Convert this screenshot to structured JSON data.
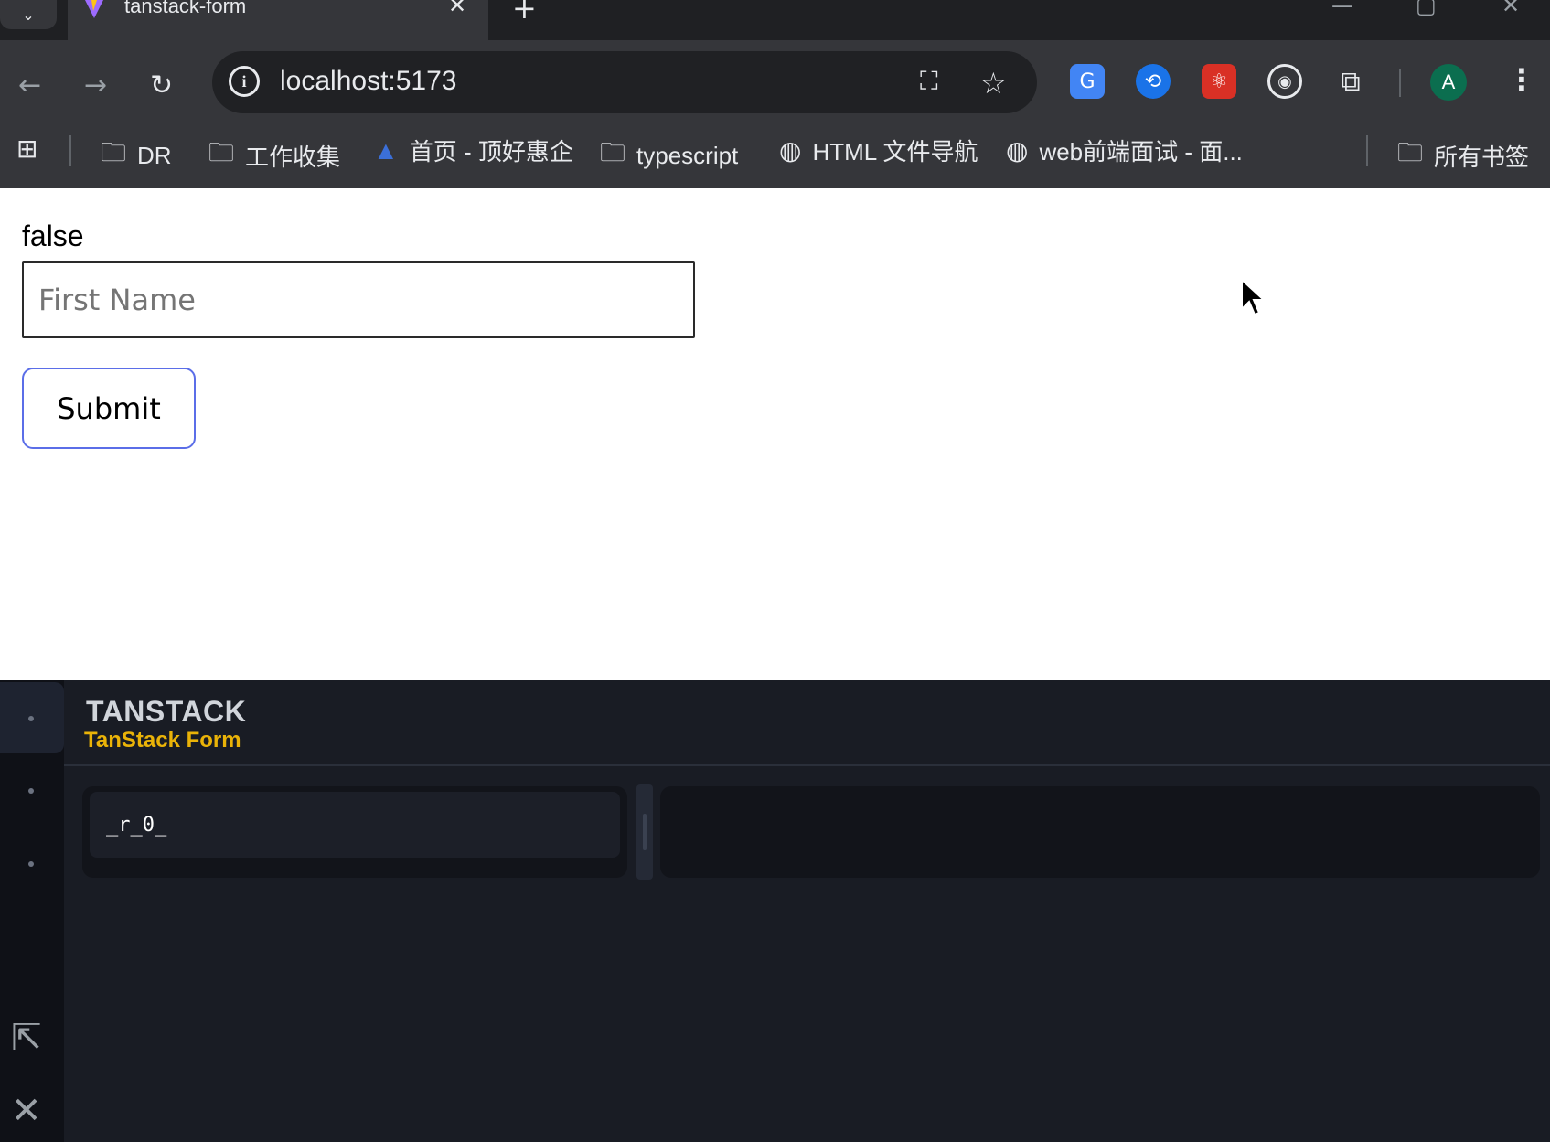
{
  "browser": {
    "tab_title": "tanstack-form",
    "url": "localhost:5173",
    "avatar_letter": "A",
    "bookmarks": [
      {
        "label": "DR"
      },
      {
        "label": "工作收集"
      },
      {
        "label": "首页 - 顶好惠企"
      },
      {
        "label": "typescript"
      },
      {
        "label": "HTML 文件导航"
      },
      {
        "label": "web前端面试 - 面..."
      }
    ],
    "all_bookmarks": "所有书签"
  },
  "form": {
    "status": "false",
    "first_name_placeholder": "First Name",
    "first_name_value": "",
    "submit_label": "Submit"
  },
  "devtools": {
    "brand": "TANSTACK",
    "product": "TanStack Form",
    "forms": [
      {
        "id": "_r_0_"
      }
    ]
  }
}
